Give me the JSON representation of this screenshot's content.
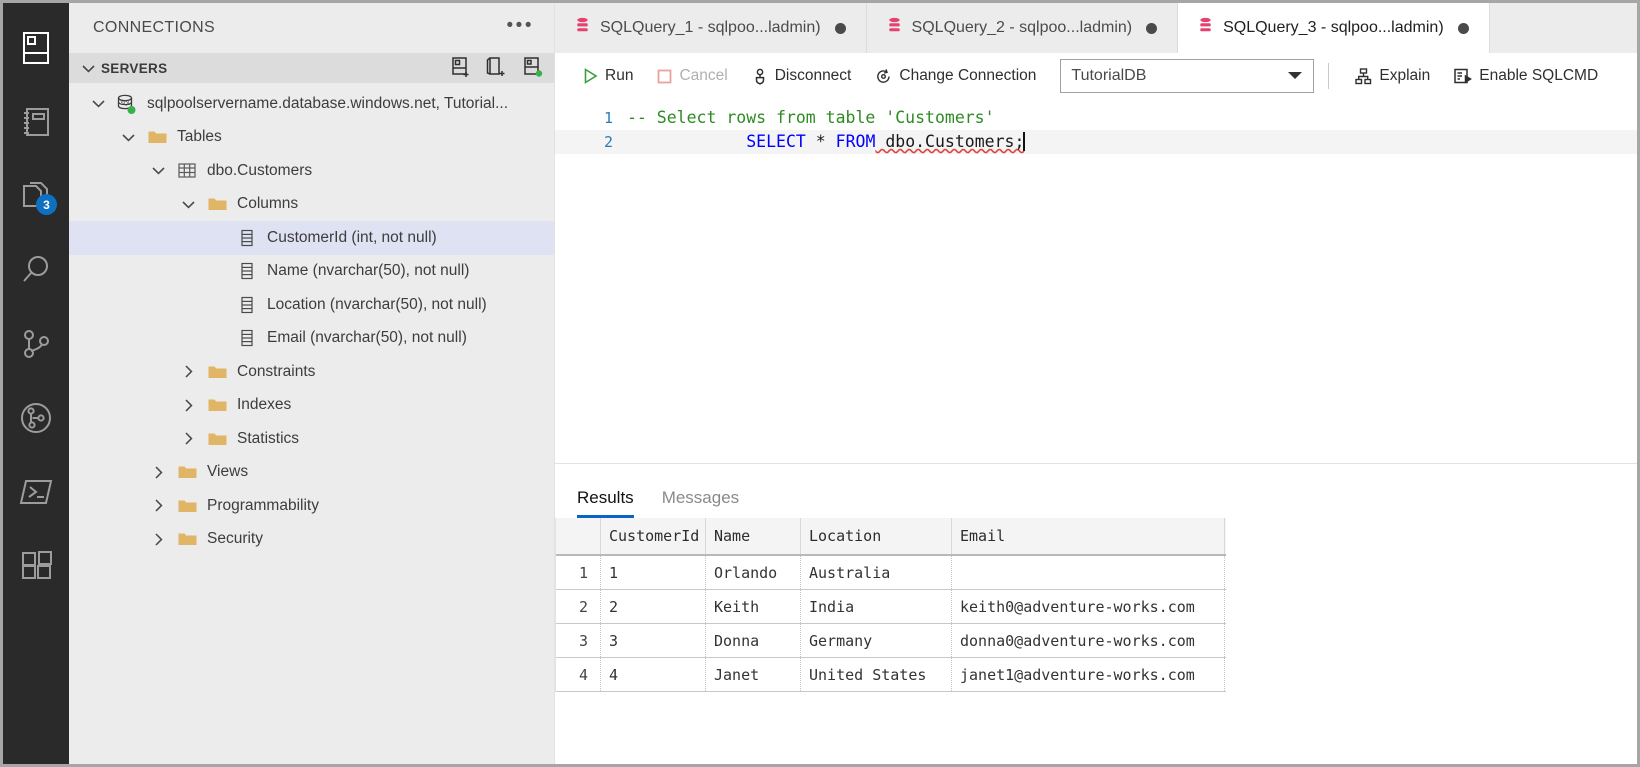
{
  "activity_bar": {
    "items": [
      {
        "name": "connections-icon",
        "label": "Connections"
      },
      {
        "name": "notebooks-icon",
        "label": "Notebooks"
      },
      {
        "name": "explorer-icon",
        "label": "Explorer",
        "badge": "3"
      },
      {
        "name": "search-icon",
        "label": "Search"
      },
      {
        "name": "source-control-icon",
        "label": "Source Control"
      },
      {
        "name": "git-graph-icon",
        "label": "Git Graph"
      },
      {
        "name": "terminal-icon",
        "label": "Terminal"
      },
      {
        "name": "extensions-icon",
        "label": "Extensions"
      }
    ]
  },
  "sidebar": {
    "title": "CONNECTIONS",
    "more_label": "•••",
    "section": {
      "label": "SERVERS",
      "actions": [
        {
          "name": "new-connection-icon",
          "label": "New Connection"
        },
        {
          "name": "new-query-icon",
          "label": "New Query"
        },
        {
          "name": "new-server-group-icon",
          "label": "New Server Group"
        }
      ]
    },
    "tree": [
      {
        "label": "sqlpoolservername.database.windows.net, Tutorial...",
        "icon": "server-icon",
        "depth": 0,
        "twist": "down",
        "selected": false
      },
      {
        "label": "Tables",
        "icon": "folder-icon",
        "depth": 1,
        "twist": "down",
        "selected": false
      },
      {
        "label": "dbo.Customers",
        "icon": "table-icon",
        "depth": 2,
        "twist": "down",
        "selected": false
      },
      {
        "label": "Columns",
        "icon": "folder-icon",
        "depth": 3,
        "twist": "down",
        "selected": false
      },
      {
        "label": "CustomerId (int, not null)",
        "icon": "column-icon",
        "depth": 4,
        "twist": "none",
        "selected": true
      },
      {
        "label": "Name (nvarchar(50), not null)",
        "icon": "column-icon",
        "depth": 4,
        "twist": "none",
        "selected": false
      },
      {
        "label": "Location (nvarchar(50), not null)",
        "icon": "column-icon",
        "depth": 4,
        "twist": "none",
        "selected": false
      },
      {
        "label": "Email (nvarchar(50), not null)",
        "icon": "column-icon",
        "depth": 4,
        "twist": "none",
        "selected": false
      },
      {
        "label": "Constraints",
        "icon": "folder-icon",
        "depth": 3,
        "twist": "right",
        "selected": false
      },
      {
        "label": "Indexes",
        "icon": "folder-icon",
        "depth": 3,
        "twist": "right",
        "selected": false
      },
      {
        "label": "Statistics",
        "icon": "folder-icon",
        "depth": 3,
        "twist": "right",
        "selected": false
      },
      {
        "label": "Views",
        "icon": "folder-icon",
        "depth": 2,
        "twist": "right",
        "selected": false
      },
      {
        "label": "Programmability",
        "icon": "folder-icon",
        "depth": 2,
        "twist": "right",
        "selected": false
      },
      {
        "label": "Security",
        "icon": "folder-icon",
        "depth": 2,
        "twist": "right",
        "selected": false
      }
    ]
  },
  "tabs": [
    {
      "label": "SQLQuery_1 - sqlpoo...ladmin)",
      "active": false,
      "dirty": true
    },
    {
      "label": "SQLQuery_2 - sqlpoo...ladmin)",
      "active": false,
      "dirty": true
    },
    {
      "label": "SQLQuery_3 - sqlpoo...ladmin)",
      "active": true,
      "dirty": true
    }
  ],
  "toolbar": {
    "run_label": "Run",
    "cancel_label": "Cancel",
    "disconnect_label": "Disconnect",
    "change_connection_label": "Change Connection",
    "database_value": "TutorialDB",
    "explain_label": "Explain",
    "enable_sqlcmd_label": "Enable SQLCMD"
  },
  "editor": {
    "lines": [
      {
        "number": "1",
        "comment": "-- Select rows from table 'Customers'"
      },
      {
        "number": "2",
        "kw1": "SELECT",
        "star": " * ",
        "kw2": "FROM",
        "obj": " dbo.Customers;"
      }
    ]
  },
  "results_panel": {
    "tabs": [
      {
        "label": "Results",
        "active": true
      },
      {
        "label": "Messages",
        "active": false
      }
    ],
    "grid": {
      "columns": [
        "",
        "CustomerId",
        "Name",
        "Location",
        "Email"
      ],
      "rows": [
        {
          "n": "1",
          "CustomerId": "1",
          "Name": "Orlando",
          "Location": "Australia",
          "Email": ""
        },
        {
          "n": "2",
          "CustomerId": "2",
          "Name": "Keith",
          "Location": "India",
          "Email": "keith0@adventure-works.com"
        },
        {
          "n": "3",
          "CustomerId": "3",
          "Name": "Donna",
          "Location": "Germany",
          "Email": "donna0@adventure-works.com"
        },
        {
          "n": "4",
          "CustomerId": "4",
          "Name": "Janet",
          "Location": "United States",
          "Email": "janet1@adventure-works.com"
        }
      ]
    }
  },
  "colors": {
    "accent": "#0a64c8",
    "badge": "#0e70c0",
    "tab_icon": "#e5406f",
    "folder": "#e0b565",
    "selection": "#dfe2f2",
    "run_green": "#3aa03a",
    "cancel_red": "#e8a49c",
    "comment_green": "#2e8b22",
    "keyword_blue": "#0000ff"
  }
}
